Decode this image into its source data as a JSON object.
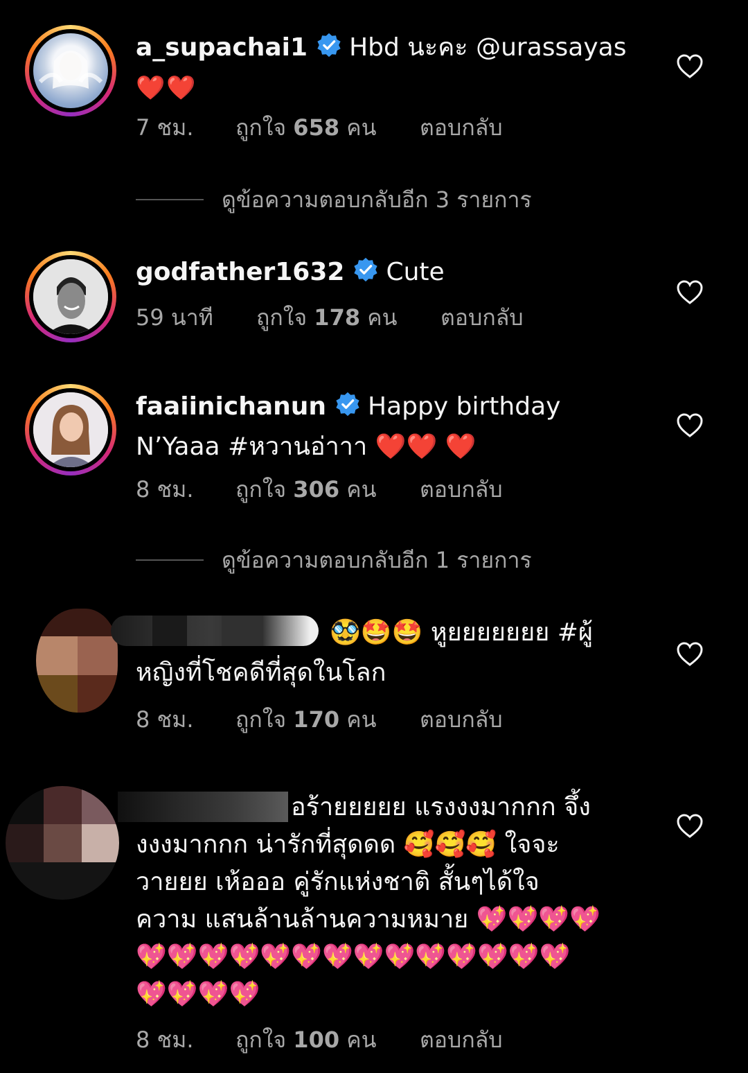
{
  "comments": [
    {
      "username": "a_supachai1",
      "verified": true,
      "text": "Hbd นะคะ @urassayas",
      "emoji_line": "❤️❤️",
      "time": "7 ชม.",
      "likes_prefix": "ถูกใจ",
      "likes": "658",
      "likes_suffix": "คน",
      "reply": "ตอบกลับ",
      "view_replies": "ดูข้อความตอบกลับอีก 3 รายการ"
    },
    {
      "username": "godfather1632",
      "verified": true,
      "text": "Cute",
      "time": "59 นาที",
      "likes_prefix": "ถูกใจ",
      "likes": "178",
      "likes_suffix": "คน",
      "reply": "ตอบกลับ"
    },
    {
      "username": "faaiinichanun",
      "verified": true,
      "text": "Happy birthday",
      "text2": "N’Yaaa #หวานอ่าาา ❤️❤️ ❤️",
      "time": "8 ชม.",
      "likes_prefix": "ถูกใจ",
      "likes": "306",
      "likes_suffix": "คน",
      "reply": "ตอบกลับ",
      "view_replies": "ดูข้อความตอบกลับอีก 1 รายการ"
    },
    {
      "username_hidden": true,
      "text": "🥸🤩🤩 หูยยยยยยย #ผู้",
      "text2": "หญิงที่โชคดีที่สุดในโลก",
      "time": "8 ชม.",
      "likes_prefix": "ถูกใจ",
      "likes": "170",
      "likes_suffix": "คน",
      "reply": "ตอบกลับ"
    },
    {
      "username_hidden": true,
      "line1": "อร้ายยยยย แรงงงมากกก จึ้ง",
      "line2": "งงงมากกก น่ารักที่สุดดด 🥰🥰🥰 ใจจะ",
      "line3": "วายยย เห้อออ คู่รักแห่งชาติ สั้นๆได้ใจ",
      "line4": "ความ แสนล้านล้านความหมาย 💖💖💖💖",
      "line5": "💖💖💖💖💖💖💖💖💖💖💖💖💖💖",
      "line6": "💖💖💖💖",
      "time": "8 ชม.",
      "likes_prefix": "ถูกใจ",
      "likes": "100",
      "likes_suffix": "คน",
      "reply": "ตอบกลับ"
    }
  ],
  "icons": {
    "like": "heart-outline-icon",
    "verified": "verified-badge-icon"
  },
  "colors": {
    "background": "#000000",
    "text": "#f5f5f5",
    "muted": "#a8a8a8",
    "verified": "#3897f0"
  }
}
